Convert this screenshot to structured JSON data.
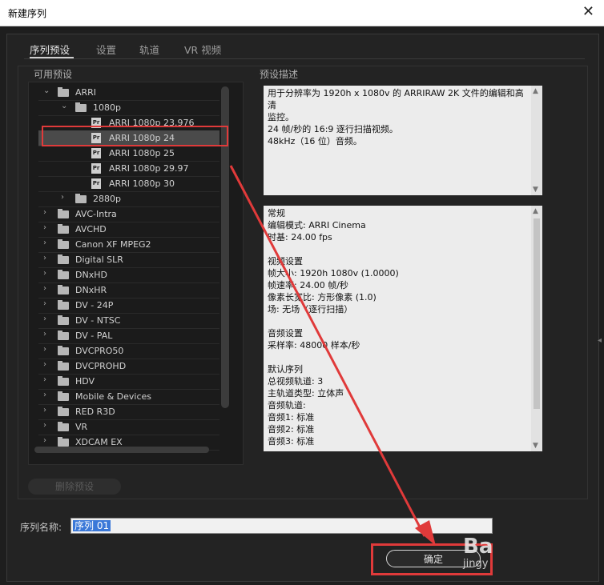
{
  "window": {
    "title": "新建序列",
    "close_glyph": "✕"
  },
  "tabs": [
    {
      "label": "序列预设"
    },
    {
      "label": "设置"
    },
    {
      "label": "轨道"
    },
    {
      "label": "VR 视频"
    }
  ],
  "left_panel": {
    "label": "可用预设"
  },
  "right_panel": {
    "label": "预设描述"
  },
  "tree": {
    "rows": [
      {
        "label": "ARRI",
        "indent": 0,
        "expanded": true,
        "kind": "folder"
      },
      {
        "label": "1080p",
        "indent": 1,
        "expanded": true,
        "kind": "folder"
      },
      {
        "label": "ARRI 1080p 23.976",
        "indent": 2,
        "kind": "preset"
      },
      {
        "label": "ARRI 1080p 24",
        "indent": 2,
        "kind": "preset",
        "selected": true
      },
      {
        "label": "ARRI 1080p 25",
        "indent": 2,
        "kind": "preset"
      },
      {
        "label": "ARRI 1080p 29.97",
        "indent": 2,
        "kind": "preset"
      },
      {
        "label": "ARRI 1080p 30",
        "indent": 2,
        "kind": "preset"
      },
      {
        "label": "2880p",
        "indent": 1,
        "expanded": false,
        "kind": "folder"
      },
      {
        "label": "AVC-Intra",
        "indent": 0,
        "expanded": false,
        "kind": "folder"
      },
      {
        "label": "AVCHD",
        "indent": 0,
        "expanded": false,
        "kind": "folder"
      },
      {
        "label": "Canon XF MPEG2",
        "indent": 0,
        "expanded": false,
        "kind": "folder"
      },
      {
        "label": "Digital SLR",
        "indent": 0,
        "expanded": false,
        "kind": "folder"
      },
      {
        "label": "DNxHD",
        "indent": 0,
        "expanded": false,
        "kind": "folder"
      },
      {
        "label": "DNxHR",
        "indent": 0,
        "expanded": false,
        "kind": "folder"
      },
      {
        "label": "DV - 24P",
        "indent": 0,
        "expanded": false,
        "kind": "folder"
      },
      {
        "label": "DV - NTSC",
        "indent": 0,
        "expanded": false,
        "kind": "folder"
      },
      {
        "label": "DV - PAL",
        "indent": 0,
        "expanded": false,
        "kind": "folder"
      },
      {
        "label": "DVCPRO50",
        "indent": 0,
        "expanded": false,
        "kind": "folder"
      },
      {
        "label": "DVCPROHD",
        "indent": 0,
        "expanded": false,
        "kind": "folder"
      },
      {
        "label": "HDV",
        "indent": 0,
        "expanded": false,
        "kind": "folder"
      },
      {
        "label": "Mobile & Devices",
        "indent": 0,
        "expanded": false,
        "kind": "folder"
      },
      {
        "label": "RED R3D",
        "indent": 0,
        "expanded": false,
        "kind": "folder"
      },
      {
        "label": "VR",
        "indent": 0,
        "expanded": false,
        "kind": "folder"
      },
      {
        "label": "XDCAM EX",
        "indent": 0,
        "expanded": false,
        "kind": "folder"
      }
    ]
  },
  "description": {
    "lines": [
      "用于分辨率为 1920h x 1080v 的 ARRIRAW 2K 文件的编辑和高清",
      "监控。",
      "24 帧/秒的 16:9 逐行扫描视频。",
      "48kHz（16 位）音频。"
    ]
  },
  "details": {
    "lines": [
      "常规",
      " 编辑模式: ARRI Cinema",
      " 时基: 24.00 fps",
      "",
      "视频设置",
      " 帧大小: 1920h 1080v (1.0000)",
      " 帧速率: 24.00 帧/秒",
      " 像素长宽比: 方形像素 (1.0)",
      " 场: 无场（逐行扫描）",
      "",
      "音频设置",
      " 采样率: 48000 样本/秒",
      "",
      "默认序列",
      " 总视频轨道: 3",
      " 主轨道类型: 立体声",
      " 音频轨道:",
      " 音频1: 标准",
      " 音频2: 标准",
      " 音频3: 标准"
    ]
  },
  "buttons": {
    "delete_preset": "删除预设",
    "ok": "确定"
  },
  "sequence_name": {
    "label": "序列名称:",
    "value": "序列 01"
  },
  "watermark": {
    "line1": "Ba",
    "line2": "jingy"
  },
  "colors": {
    "highlight_red": "#e03a3a",
    "selection_blue": "#3a78d8"
  }
}
